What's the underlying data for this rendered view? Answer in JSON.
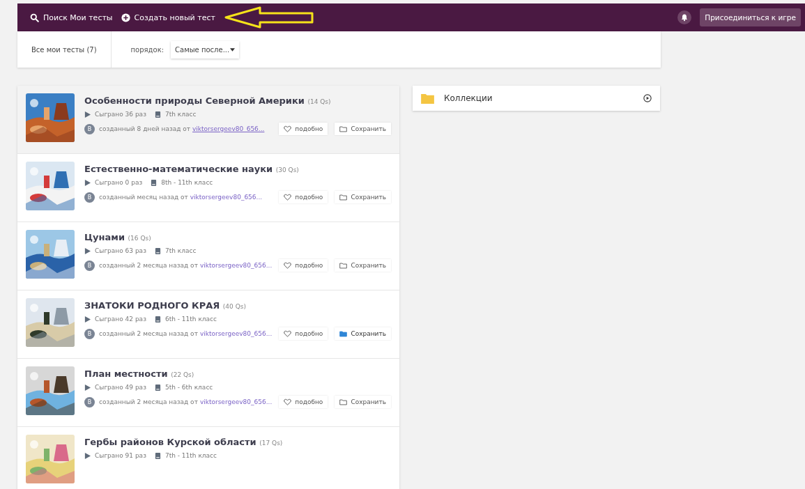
{
  "top_bar": {
    "search_label": "Поиск Мои тесты",
    "create_label": "Создать новый тест",
    "join_button": "Присоединиться к игре"
  },
  "filter": {
    "all_tests": "Все мои тесты (7)",
    "order_label": "порядок:",
    "order_value": "Самые после..."
  },
  "quizzes": [
    {
      "title": "Особенности природы Северной Америки",
      "count": "(14 Qs)",
      "played": "Сыграно 36 раз",
      "grade": "7th класс",
      "avatar": "В",
      "created": "созданный 8 дней назад от",
      "author": "viktorsergeev80_656...",
      "like": "подобно",
      "save": "Сохранить",
      "saved": false,
      "highlighted": true
    },
    {
      "title": "Естественно-математические науки",
      "count": "(30 Qs)",
      "played": "Сыграно 0 раз",
      "grade": "8th - 11th класс",
      "avatar": "В",
      "created": "созданный месяц назад от",
      "author": "viktorsergeev80_656...",
      "like": "подобно",
      "save": "Сохранить",
      "saved": false,
      "highlighted": false
    },
    {
      "title": "Цунами",
      "count": "(16 Qs)",
      "played": "Сыграно 63 раз",
      "grade": "7th класс",
      "avatar": "В",
      "created": "созданный 2 месяца назад от",
      "author": "viktorsergeev80_656...",
      "like": "подобно",
      "save": "Сохранить",
      "saved": false,
      "highlighted": false
    },
    {
      "title": "ЗНАТОКИ РОДНОГО КРАЯ",
      "count": "(40 Qs)",
      "played": "Сыграно 42 раз",
      "grade": "6th - 11th класс",
      "avatar": "В",
      "created": "созданный 2 месяца назад от",
      "author": "viktorsergeev80_656...",
      "like": "подобно",
      "save": "Сохранить",
      "saved": true,
      "highlighted": false
    },
    {
      "title": "План местности",
      "count": "(22 Qs)",
      "played": "Сыграно 49 раз",
      "grade": "5th - 6th класс",
      "avatar": "В",
      "created": "созданный 2 месяца назад от",
      "author": "viktorsergeev80_656...",
      "like": "подобно",
      "save": "Сохранить",
      "saved": false,
      "highlighted": false
    },
    {
      "title": "Гербы районов Курской области",
      "count": "(17 Qs)",
      "played": "Сыграно 91 раз",
      "grade": "7th - 11th класс",
      "highlighted": false
    }
  ],
  "collections": {
    "title": "Коллекции"
  }
}
